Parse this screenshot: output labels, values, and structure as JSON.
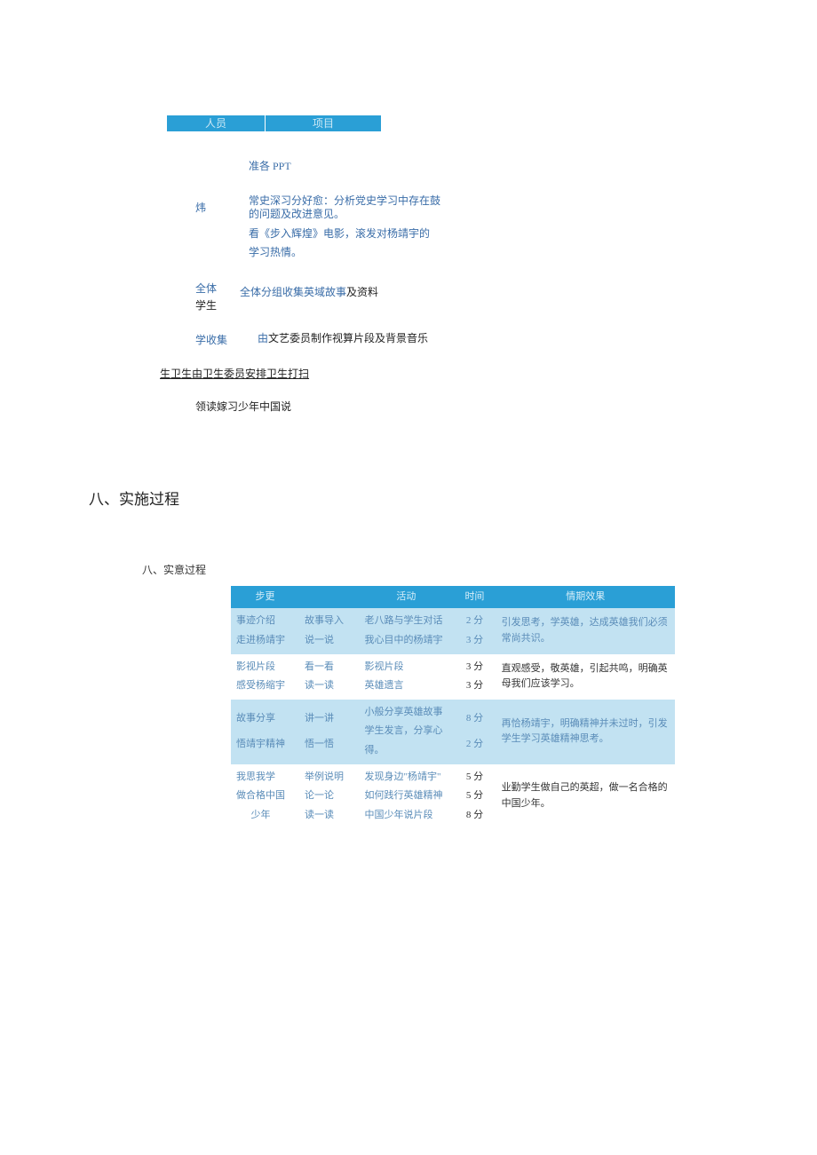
{
  "header": {
    "col1": "人员",
    "col2": "项目"
  },
  "top_items": {
    "ppt": "准各 PPT",
    "teacher_label": "炜",
    "teacher_line1": "常史深习分好愈：分析党史学习中存在鼓",
    "teacher_line2": "的问题及改进意见。",
    "teacher_line3": "看《步入辉煌》电影，滚发对杨靖宇的",
    "teacher_line4": "学习热情。",
    "students_label1": "全体",
    "students_label2": "学生",
    "students_content": "全体分组收集英域故事及资料",
    "collect_label": "学收集",
    "collect_content": "由文艺委员制作视算片段及背景音乐",
    "hygiene": "卫生由卫生委员安排卫生打扫",
    "hygiene_prefix": "生",
    "read": "领读嫁习少年中国说"
  },
  "section8_title": "八、实施过程",
  "section8_sub": "八、实意过程",
  "table": {
    "head": {
      "c1": "步更",
      "c2": "",
      "c3": "活动",
      "c4": "时间",
      "c5": "情期效果"
    },
    "row1": {
      "a1": "事迹介绍",
      "a2": "故事导入",
      "a3": "老八路与学生对话",
      "a4": "2 分",
      "b1": "走进杨靖宇",
      "b2": "说一说",
      "b3": "我心目中的杨靖宇",
      "b4": "3 分",
      "effect": "引发思考，学英雄，达成英雄我们必须常尚共识。"
    },
    "row2": {
      "a1": "影视片段",
      "a2": "看一看",
      "a3": "影视片段",
      "a4": "3 分",
      "b1": "感受杨缩宇",
      "b2": "读一读",
      "b3": "英雄遗言",
      "b4": "3 分",
      "effect": "直观感受，敬英雄，引起共鸣，明确英母我们应该学习。"
    },
    "row3": {
      "a1": "故事分享",
      "a2": "讲一讲",
      "a3": "小般分享英雄故事",
      "a4": "8 分",
      "b1": "悟靖宇精神",
      "b2": "悟一悟",
      "b3a": "学生发言，分享心",
      "b3b": "得。",
      "b4": "2 分",
      "effect": "再恰杨靖宇，明确精神并未过时，引发学生学习英雄精神思考。"
    },
    "row4": {
      "a1": "我思我学",
      "a2": "举例说明",
      "a3": "发现身边\"杨靖宇\"",
      "a4": "5 分",
      "b1": "做合格中国",
      "b2": "论一论",
      "b3": "如何践行英雄精神",
      "b4": "5 分",
      "c1": "少年",
      "c2": "读一读",
      "c3": "中国少年说片段",
      "c4": "8 分",
      "effect": "业勤学生做自己的英超，做一名合格的中国少年。"
    }
  }
}
